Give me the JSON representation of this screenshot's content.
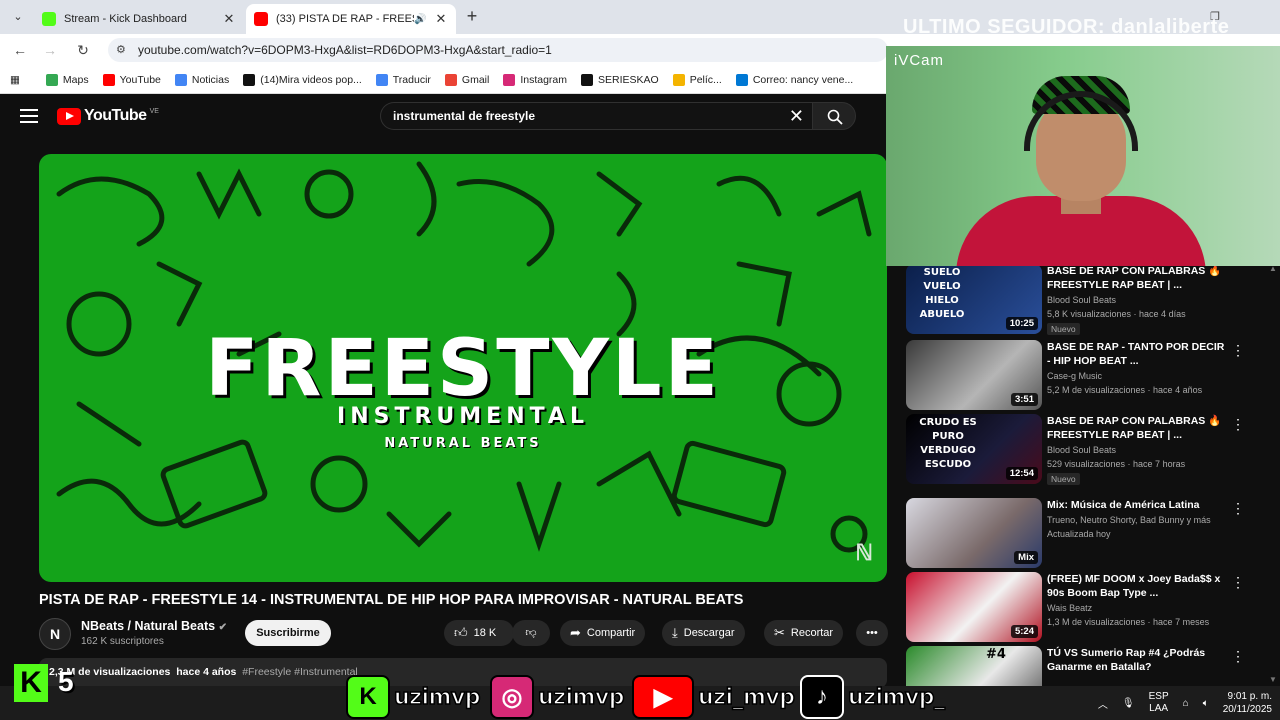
{
  "browser": {
    "tabs": [
      {
        "title": "Stream - Kick Dashboard",
        "favicon_color": "#53fc18"
      },
      {
        "title": "(33) PISTA DE RAP - FREEST",
        "favicon_color": "#ff0000"
      }
    ],
    "url": "youtube.com/watch?v=6DOPM3-HxgA&list=RD6DOPM3-HxgA&start_radio=1",
    "bookmarks": [
      {
        "label": "Maps",
        "color": "#34a853"
      },
      {
        "label": "YouTube",
        "color": "#ff0000"
      },
      {
        "label": "Noticias",
        "color": "#4285f4"
      },
      {
        "label": "(14)Mira videos pop...",
        "color": "#111111"
      },
      {
        "label": "Traducir",
        "color": "#4285f4"
      },
      {
        "label": "Gmail",
        "color": "#ea4335"
      },
      {
        "label": "Instagram",
        "color": "#d62976"
      },
      {
        "label": "SERIESKAO",
        "color": "#111111"
      },
      {
        "label": "Pelíc...",
        "color": "#f4b400"
      },
      {
        "label": "Correo: nancy vene...",
        "color": "#0078d4"
      }
    ]
  },
  "youtube": {
    "logo_word": "YouTube",
    "country_code": "VE",
    "search_query": "instrumental de freestyle",
    "video": {
      "thumb_title": "FREESTYLE",
      "thumb_subtitle": "INSTRUMENTAL",
      "thumb_brand": "NATURAL BEATS",
      "title": "PISTA DE RAP - FREESTYLE 14 - INSTRUMENTAL DE HIP HOP PARA IMPROVISAR - NATURAL BEATS",
      "channel": "NBeats / Natural Beats",
      "subscribers": "162 K suscriptores",
      "subscribe_label": "Suscribirme",
      "likes": "18 K",
      "share_label": "Compartir",
      "download_label": "Descargar",
      "clip_label": "Recortar",
      "views": "2,3 M de visualizaciones",
      "age": "hace 4 años",
      "tags": "#Freestyle #Instrumental"
    },
    "recommendations": [
      {
        "title": "BASE DE RAP CON PALABRAS 🔥FREESTYLE RAP BEAT | ...",
        "channel": "Blood Soul Beats",
        "meta": "5,8 K visualizaciones · hace 4 días",
        "duration": "10:25",
        "badge": "Nuevo",
        "thumb_text": "SUELO VUELO HIELO ABUELO"
      },
      {
        "title": "BASE DE RAP - TANTO POR DECIR - HIP HOP BEAT ...",
        "channel": "Case-g Music",
        "meta": "5,2 M de visualizaciones · hace 4 años",
        "duration": "3:51",
        "badge": "",
        "thumb_text": ""
      },
      {
        "title": "BASE DE RAP CON PALABRAS 🔥FREESTYLE RAP BEAT | ...",
        "channel": "Blood Soul Beats",
        "meta": "529 visualizaciones · hace 7 horas",
        "duration": "12:54",
        "badge": "Nuevo",
        "thumb_text": "CRUDO ES PURO VERDUGO ESCUDO"
      },
      {
        "title": "Mix: Música de América Latina",
        "channel": "Trueno, Neutro Shorty, Bad Bunny y más",
        "meta": "Actualizada hoy",
        "duration": "Mix",
        "badge": "",
        "thumb_text": ""
      },
      {
        "title": "(FREE) MF DOOM x Joey Bada$$ x 90s Boom Bap Type ...",
        "channel": "Wais Beatz",
        "meta": "1,3 M de visualizaciones · hace 7 meses",
        "duration": "5:24",
        "badge": "",
        "thumb_text": ""
      },
      {
        "title": "TÚ VS Sumerio Rap #4 ¿Podrás Ganarme en Batalla?",
        "channel": "",
        "meta": "",
        "duration": "",
        "badge": "",
        "thumb_text": "#4"
      }
    ]
  },
  "stream_overlay": {
    "follower_text": "ULTIMO SEGUIDOR: danlaliberte",
    "cam_label": "iVCam",
    "kick_count": "5",
    "handles": [
      {
        "platform": "kick",
        "handle": "uzimvp",
        "color": "#53fc18"
      },
      {
        "platform": "instagram",
        "handle": "uzimvp",
        "color": "#d62976"
      },
      {
        "platform": "youtube",
        "handle": "uzi_mvp",
        "color": "#ff0000"
      },
      {
        "platform": "tiktok",
        "handle": "uzimvp_",
        "color": "#000000"
      }
    ]
  },
  "taskbar": {
    "lang1": "ESP",
    "lang2": "LAA",
    "time": "9:01 p. m.",
    "date": "20/11/2025"
  }
}
